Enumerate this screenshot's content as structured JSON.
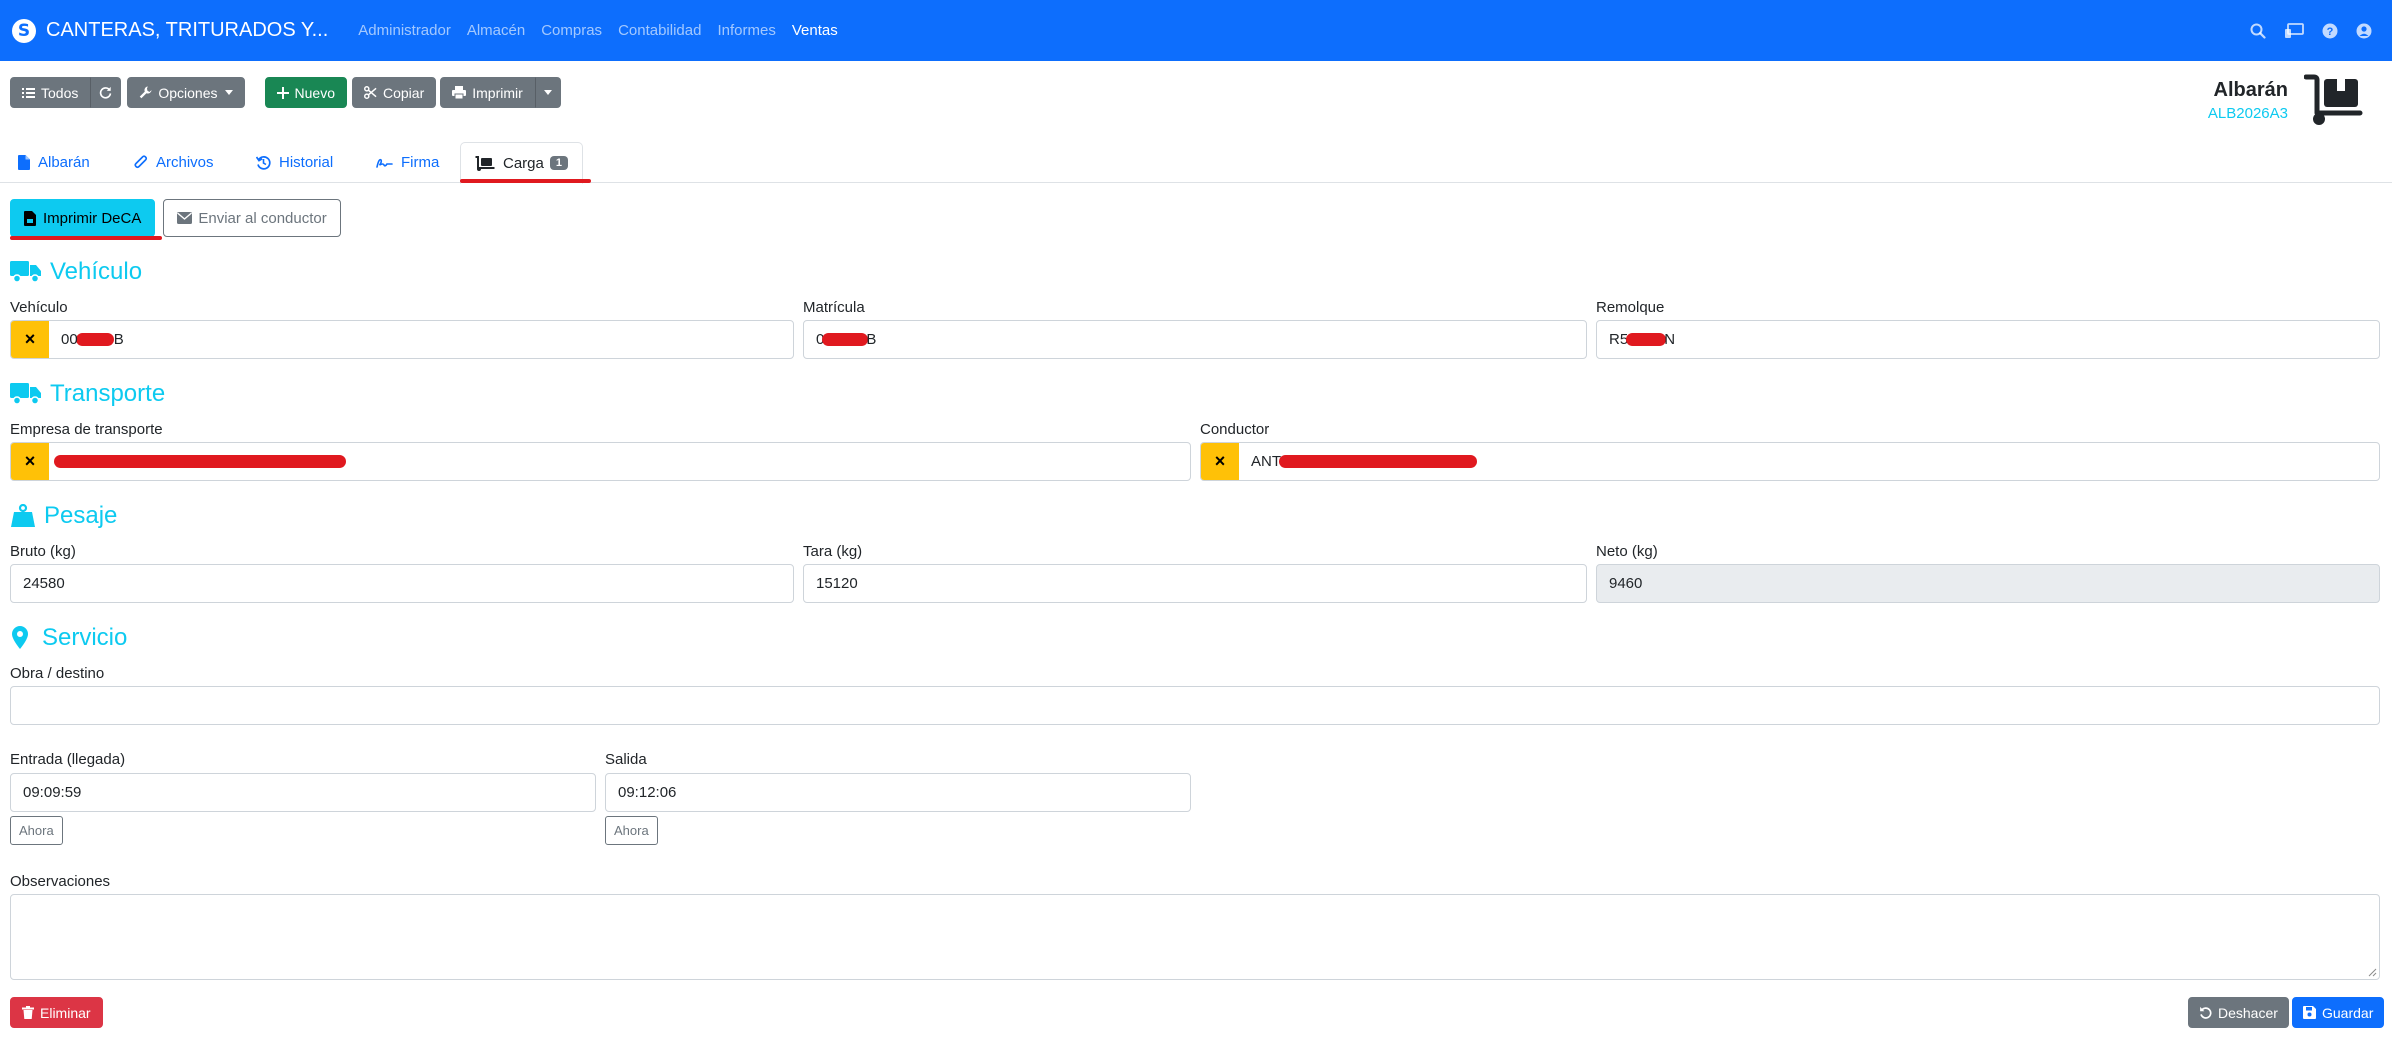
{
  "navbar": {
    "brand": "CANTERAS, TRITURADOS Y...",
    "menu": [
      "Administrador",
      "Almacén",
      "Compras",
      "Contabilidad",
      "Informes",
      "Ventas"
    ],
    "active_menu": "Ventas"
  },
  "toolbar": {
    "all_label": "Todos",
    "options_label": "Opciones",
    "new_label": "Nuevo",
    "copy_label": "Copiar",
    "print_label": "Imprimir"
  },
  "doc": {
    "title": "Albarán",
    "code": "ALB2026A3"
  },
  "tabs": [
    {
      "label": "Albarán"
    },
    {
      "label": "Archivos"
    },
    {
      "label": "Historial"
    },
    {
      "label": "Firma"
    },
    {
      "label": "Carga",
      "badge": "1"
    }
  ],
  "actions": {
    "print_deca": "Imprimir DeCA",
    "send_driver": "Enviar al conductor"
  },
  "vehiculo": {
    "title": "Vehículo",
    "vehiculo_label": "Vehículo",
    "vehiculo_value_prefix": "00",
    "vehiculo_value_suffix": "B",
    "matricula_label": "Matrícula",
    "matricula_value_prefix": "0",
    "matricula_value_suffix": "B",
    "remolque_label": "Remolque",
    "remolque_value_prefix": "R5",
    "remolque_value_suffix": "N"
  },
  "transporte": {
    "title": "Transporte",
    "empresa_label": "Empresa de transporte",
    "conductor_label": "Conductor",
    "conductor_value_prefix": "ANT"
  },
  "pesaje": {
    "title": "Pesaje",
    "bruto_label": "Bruto (kg)",
    "bruto_value": "24580",
    "tara_label": "Tara (kg)",
    "tara_value": "15120",
    "neto_label": "Neto (kg)",
    "neto_value": "9460"
  },
  "servicio": {
    "title": "Servicio",
    "obra_label": "Obra / destino",
    "obra_value": "",
    "entrada_label": "Entrada (llegada)",
    "entrada_value": "09:09:59",
    "salida_label": "Salida",
    "salida_value": "09:12:06",
    "now_label": "Ahora",
    "observaciones_label": "Observaciones"
  },
  "footer": {
    "delete_label": "Eliminar",
    "undo_label": "Deshacer",
    "save_label": "Guardar"
  },
  "colors": {
    "primary": "#0d6efd",
    "info": "#0dcaf0",
    "warning": "#ffc107",
    "danger": "#dc3545",
    "success": "#198754",
    "redaction": "#e0191f"
  }
}
